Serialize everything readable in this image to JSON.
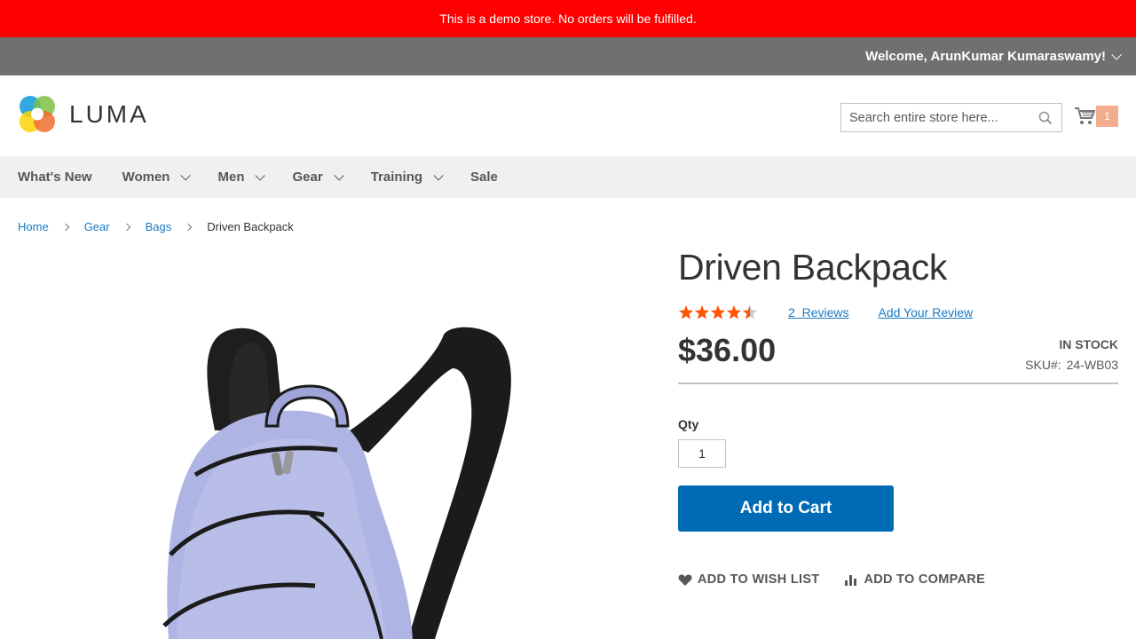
{
  "demo_notice": "This is a demo store. No orders will be fulfilled.",
  "header": {
    "welcome": "Welcome, ArunKumar Kumaraswamy!"
  },
  "logo": {
    "text": "LUMA"
  },
  "search": {
    "placeholder": "Search entire store here..."
  },
  "cart": {
    "count": "1"
  },
  "nav": {
    "items": [
      {
        "label": "What's New",
        "has_dropdown": false
      },
      {
        "label": "Women",
        "has_dropdown": true
      },
      {
        "label": "Men",
        "has_dropdown": true
      },
      {
        "label": "Gear",
        "has_dropdown": true
      },
      {
        "label": "Training",
        "has_dropdown": true
      },
      {
        "label": "Sale",
        "has_dropdown": false
      }
    ]
  },
  "breadcrumbs": {
    "items": [
      "Home",
      "Gear",
      "Bags"
    ],
    "current": "Driven Backpack"
  },
  "product": {
    "name": "Driven Backpack",
    "rating_fraction": 0.9,
    "reviews_count": "2",
    "reviews_label": "Reviews",
    "add_review_label": "Add Your Review",
    "price": "$36.00",
    "stock": "IN STOCK",
    "sku_label": "SKU#:",
    "sku": "24-WB03",
    "qty_label": "Qty",
    "qty": "1",
    "add_to_cart_label": "Add to Cart",
    "wishlist_label": "ADD TO WISH LIST",
    "compare_label": "ADD TO COMPARE"
  },
  "colors": {
    "demo_bar": "#ff0000",
    "header_panel": "#6e716e",
    "primary_button": "#006bb4",
    "link": "#1979c3",
    "star": "#ff5501",
    "cart_badge": "#f1a583"
  }
}
